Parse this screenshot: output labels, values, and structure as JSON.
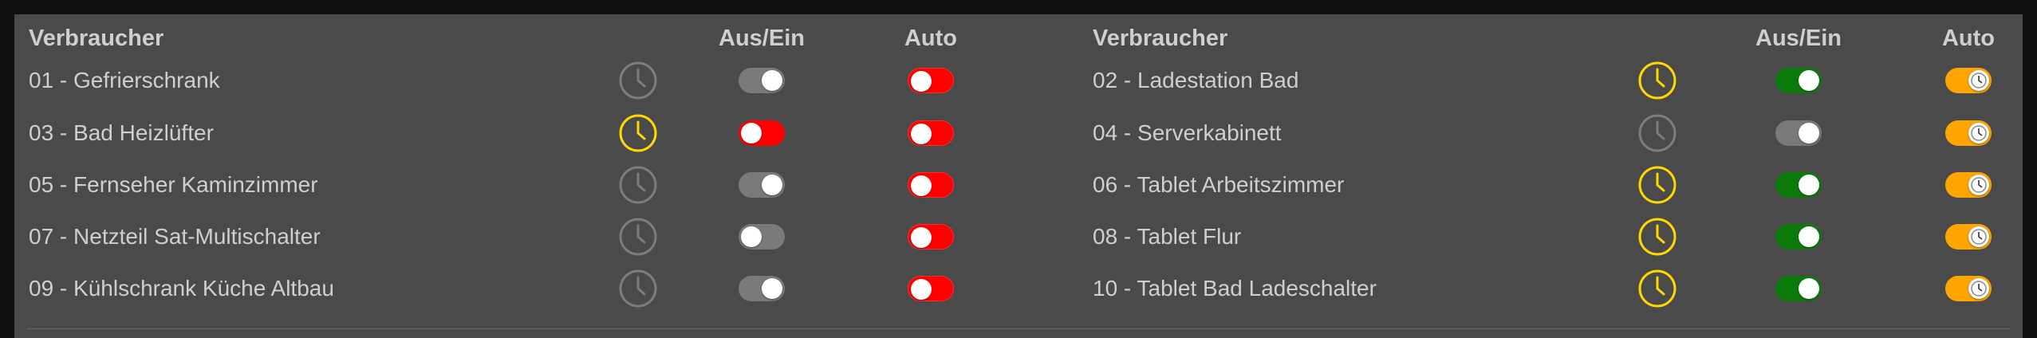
{
  "colors": {
    "panel": "#4a4a4a",
    "text": "#cfcfcf",
    "clock_inactive": "#7c7c7c",
    "clock_active": "#ffd800",
    "toggle_grey": "#7a7a7a",
    "toggle_red": "#ff0000",
    "toggle_green": "#0b7a0b",
    "toggle_orange": "#ffa500",
    "auto_off_border": "#ff2a2a"
  },
  "left": {
    "header_name": "Verbraucher",
    "header_onoff": "Aus/Ein",
    "header_auto": "Auto",
    "rows": [
      {
        "name": "01 - Gefrierschrank",
        "timer_active": false,
        "onoff": {
          "on": true,
          "color": "grey"
        },
        "auto": false
      },
      {
        "name": "03 - Bad Heizlüfter",
        "timer_active": true,
        "onoff": {
          "on": false,
          "color": "red"
        },
        "auto": false
      },
      {
        "name": "05 - Fernseher Kaminzimmer",
        "timer_active": false,
        "onoff": {
          "on": true,
          "color": "grey"
        },
        "auto": false
      },
      {
        "name": "07 - Netzteil Sat-Multischalter",
        "timer_active": false,
        "onoff": {
          "on": false,
          "color": "grey"
        },
        "auto": false
      },
      {
        "name": "09 - Kühlschrank Küche Altbau",
        "timer_active": false,
        "onoff": {
          "on": true,
          "color": "grey"
        },
        "auto": false
      }
    ]
  },
  "right": {
    "header_name": "Verbraucher",
    "header_onoff": "Aus/Ein",
    "header_auto": "Auto",
    "rows": [
      {
        "name": "02 - Ladestation Bad",
        "timer_active": true,
        "onoff": {
          "on": true,
          "color": "green"
        },
        "auto": true
      },
      {
        "name": "04 - Serverkabinett",
        "timer_active": false,
        "onoff": {
          "on": true,
          "color": "grey"
        },
        "auto": true
      },
      {
        "name": "06 - Tablet Arbeitszimmer",
        "timer_active": true,
        "onoff": {
          "on": true,
          "color": "green"
        },
        "auto": true
      },
      {
        "name": "08 - Tablet Flur",
        "timer_active": true,
        "onoff": {
          "on": true,
          "color": "green"
        },
        "auto": true
      },
      {
        "name": "10 - Tablet Bad Ladeschalter",
        "timer_active": true,
        "onoff": {
          "on": true,
          "color": "green"
        },
        "auto": true
      }
    ]
  }
}
